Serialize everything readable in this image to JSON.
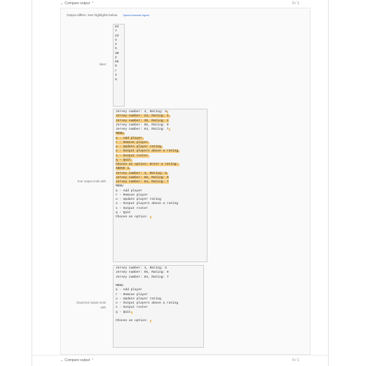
{
  "header": {
    "label": "Compare output",
    "icon": "chevron-up-icon",
    "score": "0 / 1"
  },
  "footer": {
    "label": "Compare output",
    "icon": "chevron-up-icon",
    "score": "0 / 1"
  },
  "status": {
    "text": "Output differs. See highlights below.",
    "legend": "Special character legend"
  },
  "input": {
    "label": "Input",
    "lines": [
      "84",
      "7",
      "23",
      "4",
      "4",
      "5",
      "30",
      "2",
      "66",
      "9",
      "r",
      "4",
      "q"
    ]
  },
  "yours": {
    "label": "Your output ends with",
    "lines": [
      {
        "t": "Jersey number: 4, Rating: 5",
        "hl": false,
        "nl": true
      },
      {
        "t": "Jersey number: 23, Rating: 4",
        "hl": true,
        "nl": true
      },
      {
        "t": "Jersey number: 30, Rating: 2",
        "hl": true,
        "nl": false
      },
      {
        "t": "Jersey number: 66, Rating: 9",
        "hl": false,
        "nl": false
      },
      {
        "t": "Jersey number: 84, Rating: 7",
        "hl": false,
        "nl": true
      },
      {
        "t": "MENU",
        "hl": true,
        "nl": true
      },
      {
        "t": "a - Add player",
        "hl": true,
        "nl": true
      },
      {
        "t": "r - Remove player",
        "hl": true,
        "nl": true
      },
      {
        "t": "u - Update player rating",
        "hl": true,
        "nl": true
      },
      {
        "t": "o - Output players above a rating",
        "hl": true,
        "nl": true
      },
      {
        "t": "s - Output roster",
        "hl": true,
        "nl": true
      },
      {
        "t": "q - Quit",
        "hl": true,
        "nl": true
      },
      {
        "t": "Choose an option: Enter a rating:",
        "hl": true,
        "nl": true
      },
      {
        "t": "ABOVE 4",
        "hl": true,
        "nl": true
      },
      {
        "t": "Jersey number: 4, Rating: 5",
        "hl": true,
        "nl": true
      },
      {
        "t": "Jersey number: 66, Rating: 9",
        "hl": true,
        "nl": false
      },
      {
        "t": "Jersey number: 84, Rating: 7",
        "hl": true,
        "nl": false
      },
      {
        "t": "MENU",
        "hl": false,
        "nl": false
      },
      {
        "t": "a - Add player",
        "hl": false,
        "nl": false
      },
      {
        "t": "r - Remove player",
        "hl": false,
        "nl": false
      },
      {
        "t": "u - Update player rating",
        "hl": false,
        "nl": false
      },
      {
        "t": "o - Output players above a rating",
        "hl": false,
        "nl": false
      },
      {
        "t": "s - Output roster",
        "hl": false,
        "nl": false
      },
      {
        "t": "q - Quit",
        "hl": false,
        "nl": false
      },
      {
        "t": "Choose an option: ",
        "hl": false,
        "nl": true
      }
    ]
  },
  "expected": {
    "label": "Expected output ends with",
    "lines": [
      {
        "t": "Jersey number: 4, Rating: 5",
        "hl": false,
        "nl": false
      },
      {
        "t": "Jersey number: 66, Rating: 9",
        "hl": false,
        "nl": false
      },
      {
        "t": "Jersey number: 84, Rating: 7",
        "hl": false,
        "nl": false
      },
      {
        "t": "",
        "hl": false,
        "nl": false
      },
      {
        "t": "MENU",
        "hl": false,
        "nl": false
      },
      {
        "t": "a - Add player",
        "hl": false,
        "nl": false
      },
      {
        "t": "r - Remove player",
        "hl": false,
        "nl": false
      },
      {
        "t": "u - Update player rating",
        "hl": false,
        "nl": false
      },
      {
        "t": "o - Output players above a rating",
        "hl": false,
        "nl": false
      },
      {
        "t": "s - Output roster",
        "hl": false,
        "nl": false
      },
      {
        "t": "q - Quit",
        "hl": false,
        "nl": true
      },
      {
        "t": "",
        "hl": false,
        "nl": false
      },
      {
        "t": "Choose an option: ",
        "hl": false,
        "nl": true
      }
    ]
  }
}
